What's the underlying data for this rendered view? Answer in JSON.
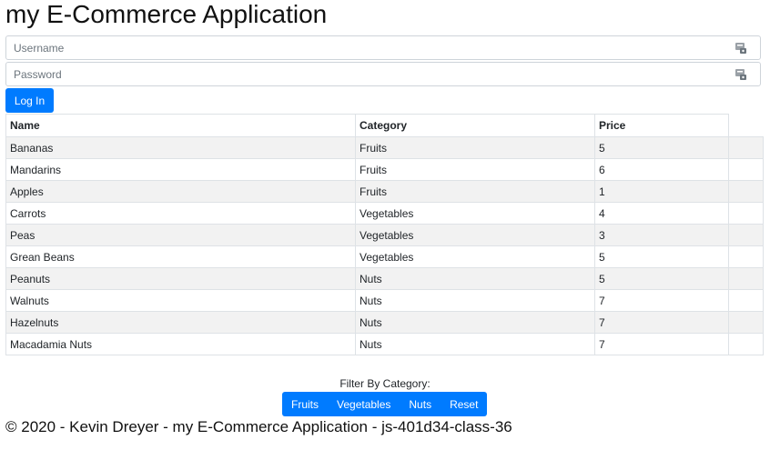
{
  "app": {
    "title": "my E-Commerce Application"
  },
  "login": {
    "username_placeholder": "Username",
    "password_placeholder": "Password",
    "button_label": "Log In",
    "field_icon": "key-icon"
  },
  "table": {
    "headers": {
      "name": "Name",
      "category": "Category",
      "price": "Price"
    },
    "rows": [
      {
        "name": "Bananas",
        "category": "Fruits",
        "price": "5"
      },
      {
        "name": "Mandarins",
        "category": "Fruits",
        "price": "6"
      },
      {
        "name": "Apples",
        "category": "Fruits",
        "price": "1"
      },
      {
        "name": "Carrots",
        "category": "Vegetables",
        "price": "4"
      },
      {
        "name": "Peas",
        "category": "Vegetables",
        "price": "3"
      },
      {
        "name": "Grean Beans",
        "category": "Vegetables",
        "price": "5"
      },
      {
        "name": "Peanuts",
        "category": "Nuts",
        "price": "5"
      },
      {
        "name": "Walnuts",
        "category": "Nuts",
        "price": "7"
      },
      {
        "name": "Hazelnuts",
        "category": "Nuts",
        "price": "7"
      },
      {
        "name": "Macadamia Nuts",
        "category": "Nuts",
        "price": "7"
      }
    ]
  },
  "filter": {
    "label": "Filter By Category:",
    "buttons": [
      "Fruits",
      "Vegetables",
      "Nuts",
      "Reset"
    ]
  },
  "footer": {
    "text": "© 2020 - Kevin Dreyer - my E-Commerce Application - js-401d34-class-36"
  },
  "colors": {
    "primary": "#007bff",
    "stripe": "#f2f2f2"
  }
}
